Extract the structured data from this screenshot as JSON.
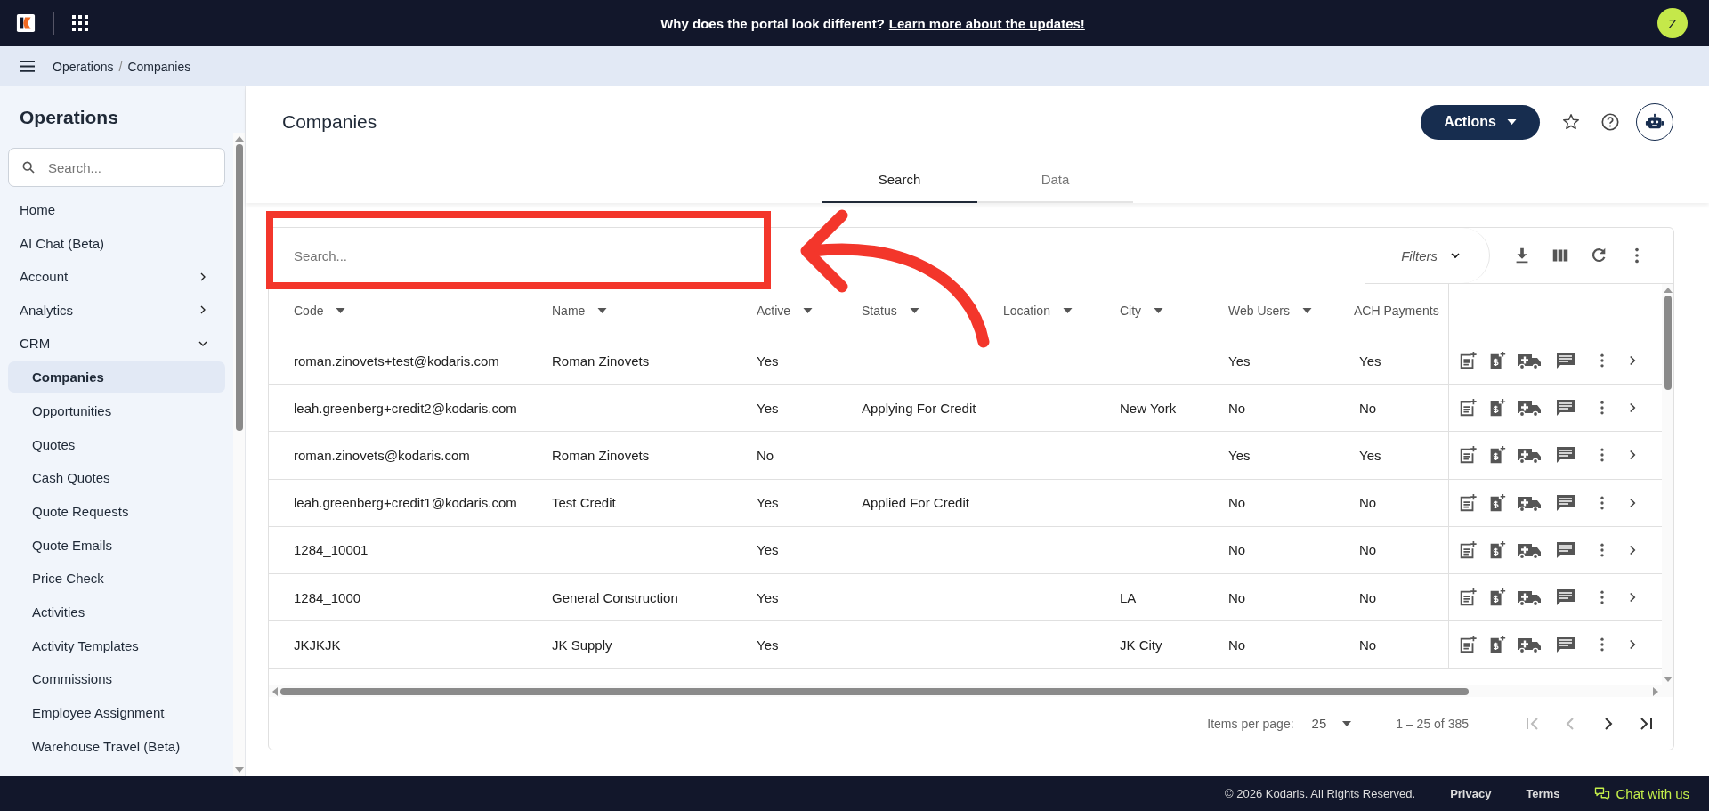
{
  "top_bar": {
    "banner_text": "Why does the portal look different?",
    "banner_link": "Learn more about the updates!",
    "avatar_initial": "Z"
  },
  "breadcrumb": {
    "separator": "/",
    "items": [
      "Operations",
      "Companies"
    ]
  },
  "sidebar": {
    "title": "Operations",
    "search_placeholder": "Search...",
    "items": [
      {
        "label": "Home",
        "selected": false
      },
      {
        "label": "AI Chat (Beta)",
        "selected": false
      },
      {
        "label": "Account",
        "selected": false,
        "expanded": false
      },
      {
        "label": "Analytics",
        "selected": false,
        "expanded": false
      },
      {
        "label": "CRM",
        "selected": false,
        "expanded": true,
        "children": [
          {
            "label": "Companies",
            "selected": true
          },
          {
            "label": "Opportunities",
            "selected": false
          },
          {
            "label": "Quotes",
            "selected": false
          },
          {
            "label": "Cash Quotes",
            "selected": false
          },
          {
            "label": "Quote Requests",
            "selected": false
          },
          {
            "label": "Quote Emails",
            "selected": false
          },
          {
            "label": "Price Check",
            "selected": false
          },
          {
            "label": "Activities",
            "selected": false
          },
          {
            "label": "Activity Templates",
            "selected": false
          },
          {
            "label": "Commissions",
            "selected": false
          },
          {
            "label": "Employee Assignment",
            "selected": false
          },
          {
            "label": "Warehouse Travel (Beta)",
            "selected": false
          }
        ]
      }
    ]
  },
  "page": {
    "title": "Companies",
    "actions_button": "Actions",
    "tabs": [
      {
        "label": "Search",
        "selected": true
      },
      {
        "label": "Data",
        "selected": false
      }
    ]
  },
  "table": {
    "search_placeholder": "Search...",
    "filters_label": "Filters",
    "columns": [
      {
        "label": "Code",
        "sortable": true
      },
      {
        "label": "Name",
        "sortable": true
      },
      {
        "label": "Active",
        "sortable": true
      },
      {
        "label": "Status",
        "sortable": true
      },
      {
        "label": "Location",
        "sortable": true
      },
      {
        "label": "City",
        "sortable": true
      },
      {
        "label": "Web Users",
        "sortable": true
      },
      {
        "label": "ACH Payments"
      }
    ],
    "rows": [
      {
        "cells": [
          "roman.zinovets+test@kodaris.com",
          "Roman Zinovets",
          "Yes",
          null,
          null,
          null,
          "Yes",
          "Yes"
        ]
      },
      {
        "cells": [
          "leah.greenberg+credit2@kodaris.com",
          null,
          "Yes",
          "Applying For Credit",
          null,
          "New York",
          "No",
          "No"
        ]
      },
      {
        "cells": [
          "roman.zinovets@kodaris.com",
          "Roman Zinovets",
          "No",
          null,
          null,
          null,
          "Yes",
          "Yes"
        ]
      },
      {
        "cells": [
          "leah.greenberg+credit1@kodaris.com",
          "Test Credit",
          "Yes",
          "Applied For Credit",
          null,
          null,
          "No",
          "No"
        ]
      },
      {
        "cells": [
          "1284_10001",
          null,
          "Yes",
          null,
          null,
          null,
          "No",
          "No"
        ]
      },
      {
        "cells": [
          "1284_1000",
          "General Construction",
          "Yes",
          null,
          null,
          "LA",
          "No",
          "No"
        ]
      },
      {
        "cells": [
          "JKJKJK",
          "JK Supply",
          "Yes",
          null,
          null,
          "JK City",
          "No",
          "No"
        ]
      }
    ],
    "paginator": {
      "items_per_page_label": "Items per page:",
      "page_size": "25",
      "range": "1 – 25 of 385",
      "nav": [
        {
          "kind": "first",
          "disabled": true
        },
        {
          "kind": "prev",
          "disabled": true
        },
        {
          "kind": "next",
          "disabled": false
        },
        {
          "kind": "last",
          "disabled": false
        }
      ]
    }
  },
  "footer": {
    "copyright": "© 2026 Kodaris. All Rights Reserved.",
    "links": [
      "Privacy",
      "Terms"
    ],
    "chat_label": "Chat with us"
  }
}
